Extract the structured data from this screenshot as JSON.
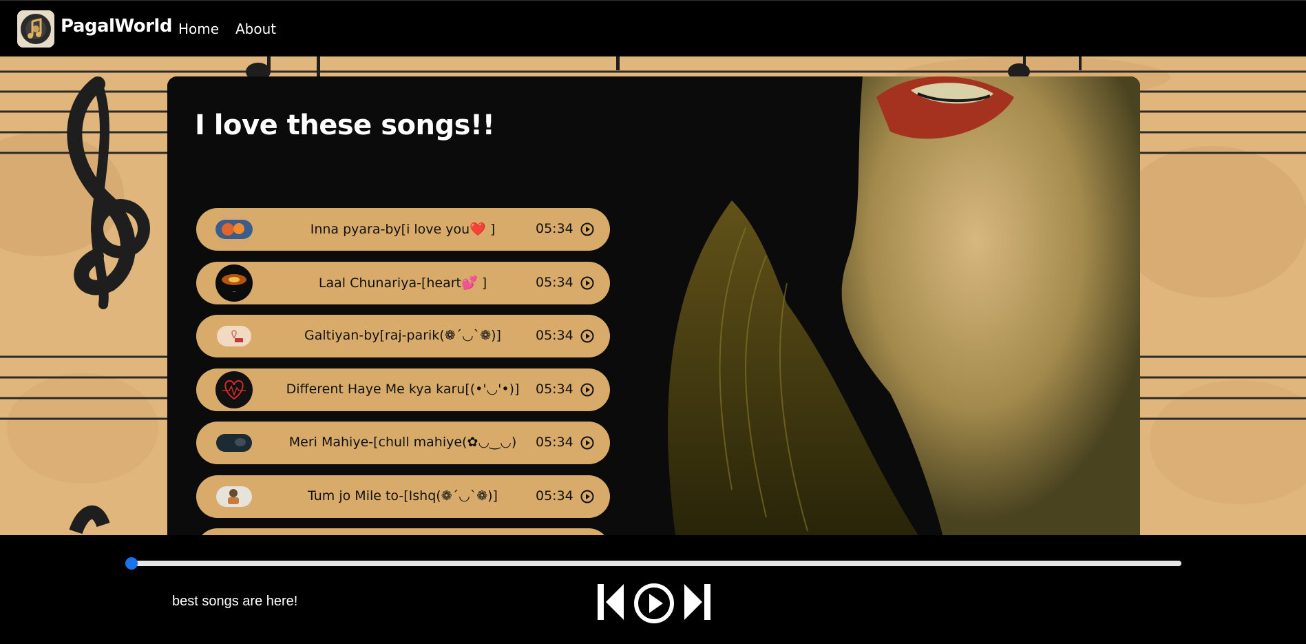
{
  "nav": {
    "brand": "PagalWorld",
    "links": [
      "Home",
      "About"
    ]
  },
  "main": {
    "heading": "I love these songs!!"
  },
  "songs": [
    {
      "name": "Inna pyara-by[i love you❤️ ]",
      "time": "05:34"
    },
    {
      "name": "Laal Chunariya-[heart💕 ]",
      "time": "05:34"
    },
    {
      "name": "Galtiyan-by[raj-parik(❁´◡`❁)]",
      "time": "05:34"
    },
    {
      "name": "Different Haye Me kya karu[(•'◡'•)]",
      "time": "05:34"
    },
    {
      "name": "Meri Mahiye-[chull mahiye(✿◡‿◡)",
      "time": "05:34"
    },
    {
      "name": "Tum jo Mile to-[Ishq(❁´◡`❁)]",
      "time": "05:34"
    }
  ],
  "player": {
    "info": "best songs are here!",
    "progress": 0
  },
  "colors": {
    "accent": "#d9ab6b",
    "background": "#e2b77c",
    "bar": "#000000",
    "thumb": "#1a73e8"
  }
}
